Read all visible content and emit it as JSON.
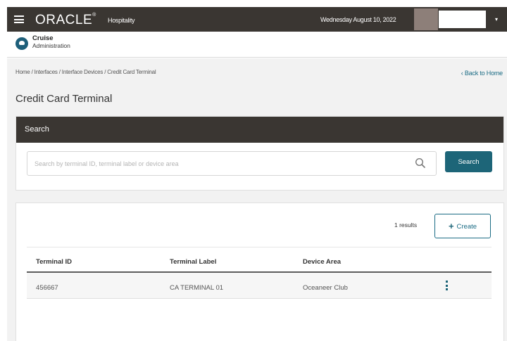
{
  "topbar": {
    "brand": "ORACLE",
    "brand_mark": "®",
    "brand_sub": "Hospitality",
    "date": "Wednesday August 10, 2022",
    "caret": "▾"
  },
  "app": {
    "title": "Cruise",
    "subtitle": "Administration"
  },
  "breadcrumb": "Home / Interfaces / Interface Devices / Credit Card Terminal",
  "back_link": "‹ Back to Home",
  "page_title": "Credit Card Terminal",
  "search": {
    "header": "Search",
    "placeholder": "Search by terminal ID, terminal label or device area",
    "value": "",
    "button_label": "Search"
  },
  "results": {
    "count_text": "1 results",
    "create_label": "Create",
    "create_icon": "+",
    "columns": [
      "Terminal ID",
      "Terminal Label",
      "Device Area"
    ],
    "rows": [
      {
        "terminal_id": "456667",
        "terminal_label": "CA TERMINAL 01",
        "device_area": "Oceaneer Club"
      }
    ]
  },
  "colors": {
    "header_bg": "#3a3632",
    "accent": "#1d6578",
    "page_bg": "#f2f2f2"
  }
}
